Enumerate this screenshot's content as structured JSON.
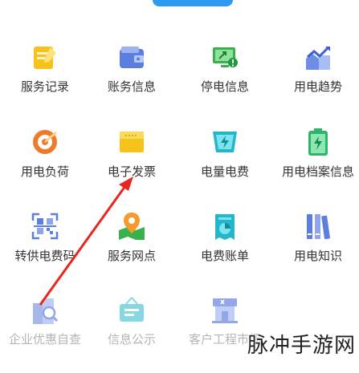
{
  "services": [
    {
      "label": "服务记录",
      "icon": "service-record-icon"
    },
    {
      "label": "账务信息",
      "icon": "wallet-icon"
    },
    {
      "label": "停电信息",
      "icon": "power-outage-icon"
    },
    {
      "label": "用电趋势",
      "icon": "trend-chart-icon"
    },
    {
      "label": "用电负荷",
      "icon": "load-gauge-icon"
    },
    {
      "label": "电子发票",
      "icon": "invoice-icon"
    },
    {
      "label": "电量电费",
      "icon": "electricity-fee-icon"
    },
    {
      "label": "用电档案信息",
      "icon": "battery-file-icon"
    },
    {
      "label": "转供电费码",
      "icon": "qr-code-icon"
    },
    {
      "label": "服务网点",
      "icon": "map-pin-icon"
    },
    {
      "label": "电费账单",
      "icon": "bill-icon"
    },
    {
      "label": "用电知识",
      "icon": "books-icon"
    },
    {
      "label": "企业优惠自查",
      "icon": "enterprise-search-icon"
    },
    {
      "label": "信息公示",
      "icon": "notice-board-icon"
    },
    {
      "label": "客户工程市场",
      "icon": "market-store-icon"
    }
  ],
  "watermark": "脉冲手游网",
  "colors": {
    "accent": "#2f9bf0",
    "annotation_arrow": "#e8261f"
  }
}
